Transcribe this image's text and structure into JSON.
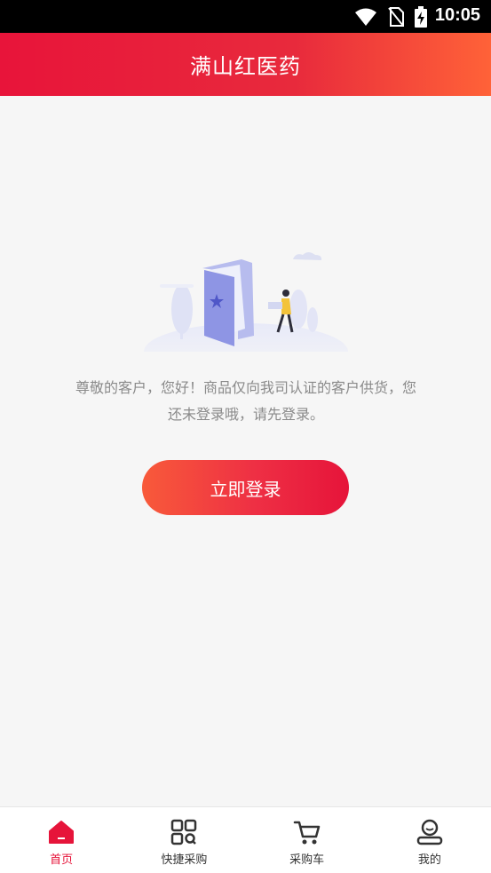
{
  "status_bar": {
    "time": "10:05"
  },
  "header": {
    "title": "满山红医药"
  },
  "main": {
    "notice": "尊敬的客户，您好！商品仅向我司认证的客户供货，您还未登录哦，请先登录。",
    "login_button": "立即登录"
  },
  "tabs": [
    {
      "label": "首页",
      "icon": "home-icon",
      "active": true
    },
    {
      "label": "快捷采购",
      "icon": "qr-scan-icon",
      "active": false
    },
    {
      "label": "采购车",
      "icon": "cart-icon",
      "active": false
    },
    {
      "label": "我的",
      "icon": "profile-icon",
      "active": false
    }
  ],
  "colors": {
    "brand": "#e6143a",
    "accent": "#ff6238"
  }
}
